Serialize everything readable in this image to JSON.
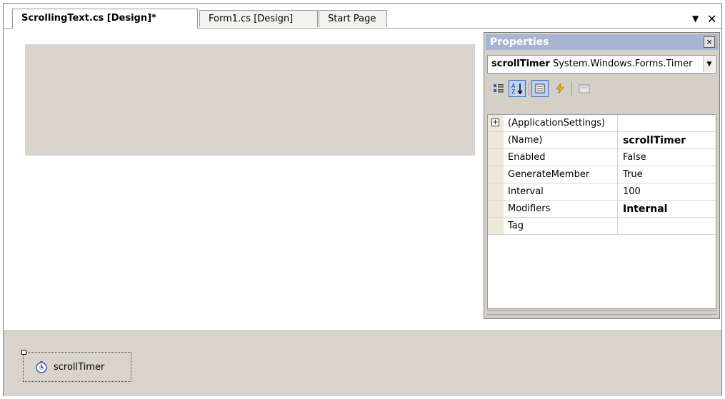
{
  "tabs": [
    {
      "label": "ScrollingText.cs [Design]*",
      "active": true
    },
    {
      "label": "Form1.cs [Design]",
      "active": false
    },
    {
      "label": "Start Page",
      "active": false
    }
  ],
  "tab_controls": {
    "dropdown_icon": "▼",
    "close_icon": "✕"
  },
  "tray": {
    "component_label": "scrollTimer",
    "component_icon": "timer-icon"
  },
  "properties": {
    "title": "Properties",
    "close_glyph": "×",
    "object_name": "scrollTimer",
    "object_type": "System.Windows.Forms.Timer",
    "toolbar": [
      "categorized-icon",
      "alphabetical-icon",
      "properties-icon",
      "events-icon",
      "property-pages-icon"
    ],
    "rows": [
      {
        "name": "(ApplicationSettings)",
        "value": "",
        "expandable": true,
        "bold": false
      },
      {
        "name": "(Name)",
        "value": "scrollTimer",
        "expandable": false,
        "bold": true
      },
      {
        "name": "Enabled",
        "value": "False",
        "expandable": false,
        "bold": false
      },
      {
        "name": "GenerateMember",
        "value": "True",
        "expandable": false,
        "bold": false
      },
      {
        "name": "Interval",
        "value": "100",
        "expandable": false,
        "bold": false
      },
      {
        "name": "Modifiers",
        "value": "Internal",
        "expandable": false,
        "bold": true
      },
      {
        "name": "Tag",
        "value": "",
        "expandable": false,
        "bold": false
      }
    ]
  },
  "colors": {
    "design_surface_bg": "#d8d4cc",
    "title_bar_bg": "#a8b5d2",
    "pressed_button": "#c1d2ee"
  }
}
